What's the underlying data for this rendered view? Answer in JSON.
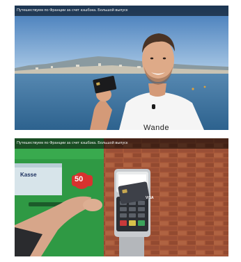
{
  "thumbnails": [
    {
      "title": "Путешествуем по Франции за счет кэшбэка. Большой выпуск",
      "shirt_text": "Wande"
    },
    {
      "title": "Путешествуем по Франции за счет кэшбэка. Большой выпуск",
      "kiosk_label": "Kasse",
      "price_label": "50",
      "card_brand": "VISA"
    }
  ],
  "colors": {
    "sky": "#6e9fcf",
    "sea": "#3f7aa6",
    "kiosk_green": "#38a64a",
    "brick": "#a45536"
  }
}
